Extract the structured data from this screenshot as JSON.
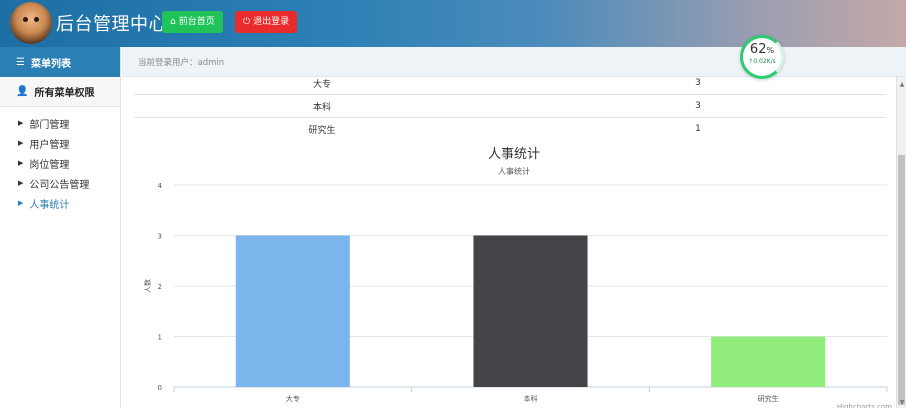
{
  "header": {
    "title": "后台管理中心",
    "home_button": "前台首页",
    "logout_button": "退出登录"
  },
  "speed": {
    "percent": "62",
    "unit": "%",
    "rate": "↑0.02K/s"
  },
  "sidebar": {
    "heading": "菜单列表",
    "group": "所有菜单权限",
    "items": [
      {
        "label": "部门管理"
      },
      {
        "label": "用户管理"
      },
      {
        "label": "岗位管理"
      },
      {
        "label": "公司公告管理"
      },
      {
        "label": "人事统计"
      }
    ]
  },
  "topbar": {
    "login_text": "当前登录用户：admin"
  },
  "table": {
    "rows": [
      {
        "name": "大专",
        "count": "3"
      },
      {
        "name": "本科",
        "count": "3"
      },
      {
        "name": "研究生",
        "count": "1"
      }
    ]
  },
  "chart_data": {
    "type": "bar",
    "title": "人事统计",
    "subtitle": "人事统计",
    "ylabel": "人数",
    "xlabel": "",
    "categories": [
      "大专",
      "本科",
      "研究生"
    ],
    "values": [
      3,
      3,
      1
    ],
    "colors": [
      "#7cb5ec",
      "#434348",
      "#90ed7d"
    ],
    "ylim": [
      0,
      4
    ],
    "yticks": [
      0,
      1,
      2,
      3,
      4
    ],
    "grid": true,
    "credit": "Highcharts.com"
  }
}
